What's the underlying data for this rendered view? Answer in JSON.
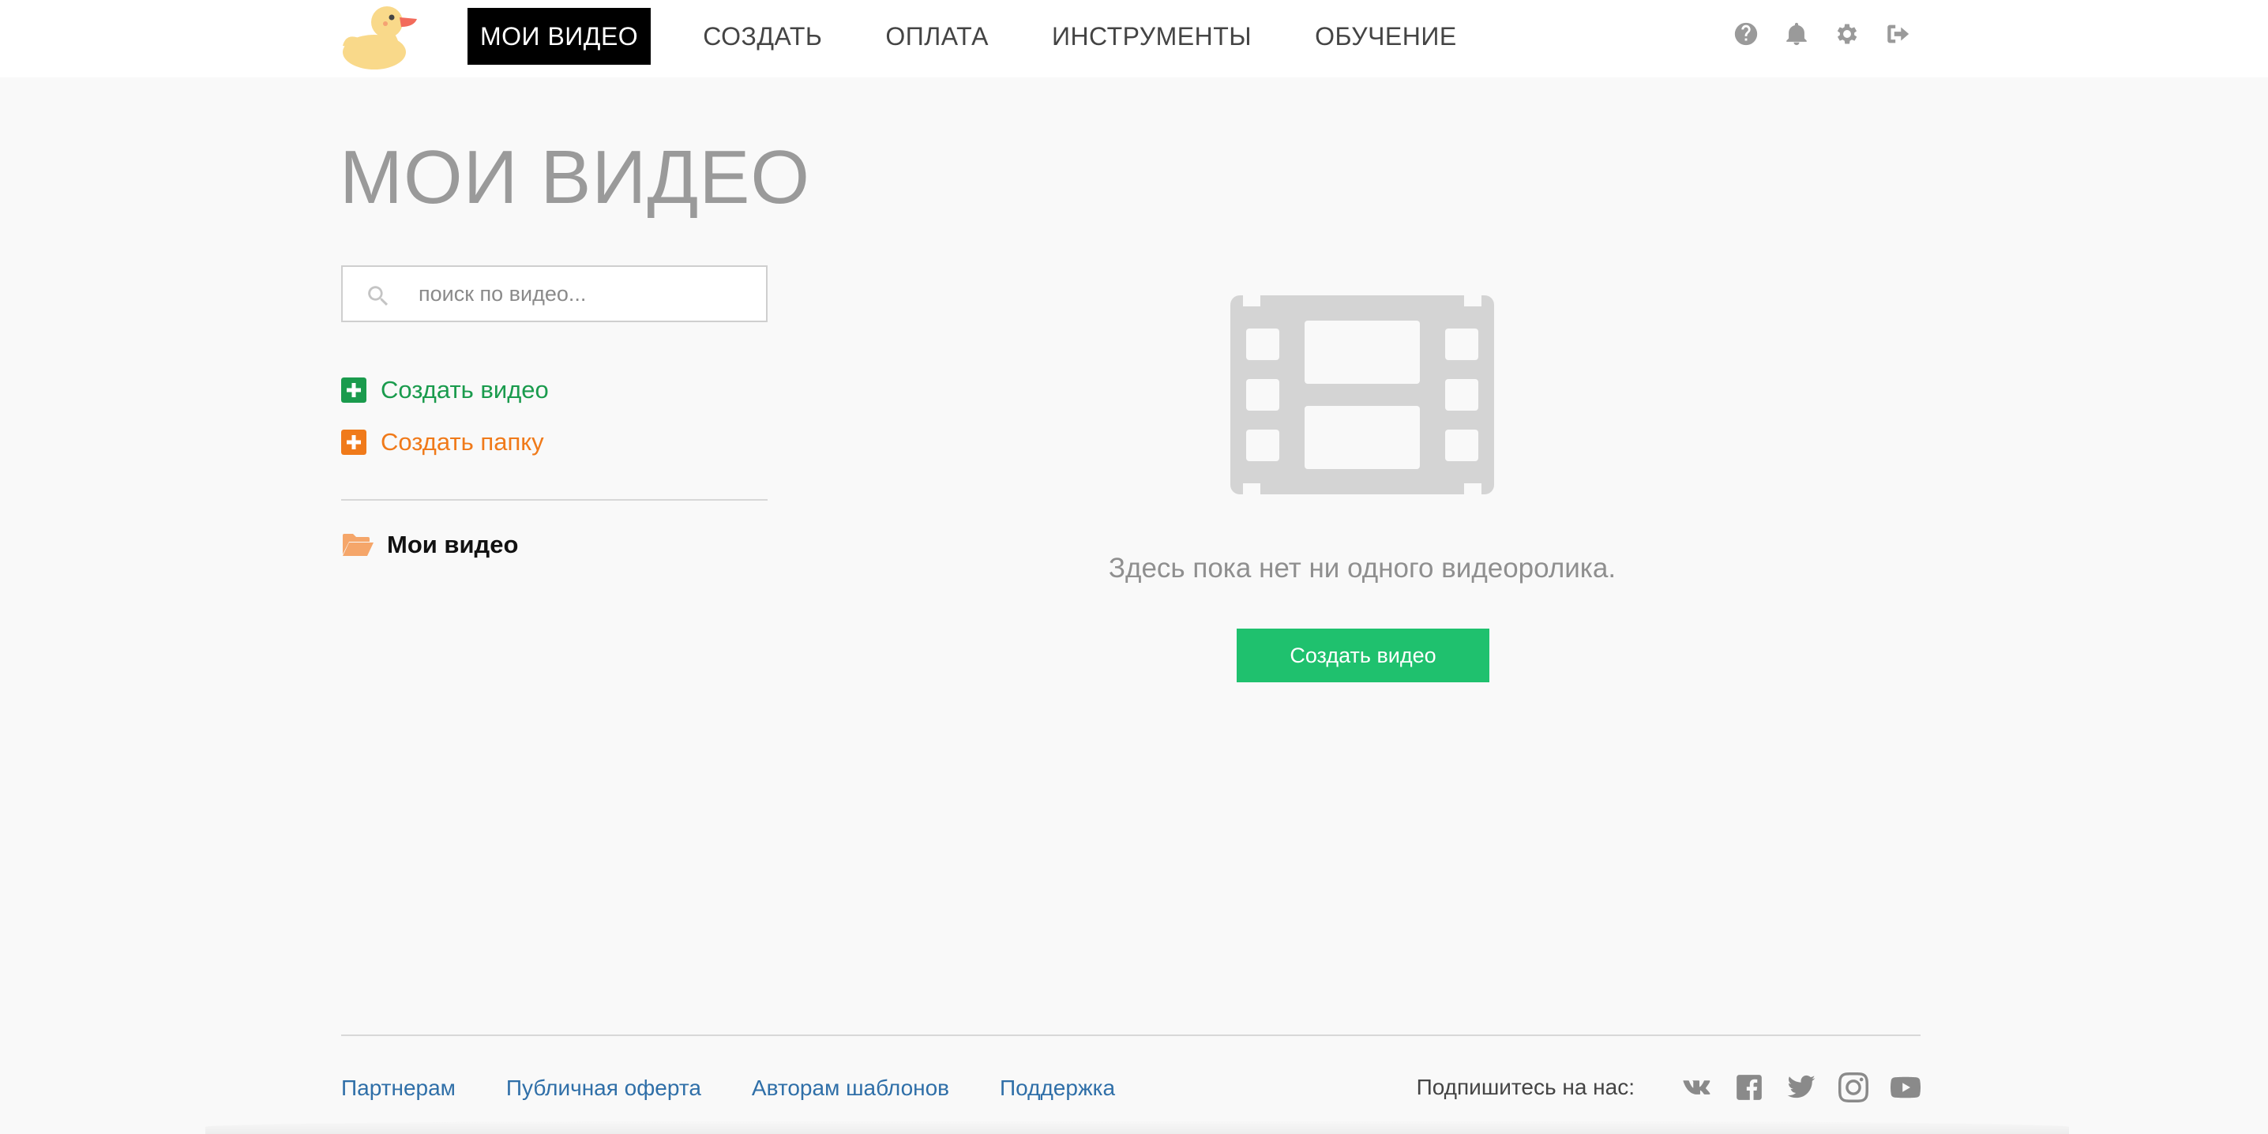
{
  "nav": {
    "items": [
      {
        "label": "МОИ ВИДЕО",
        "active": true
      },
      {
        "label": "СОЗДАТЬ",
        "active": false
      },
      {
        "label": "ОПЛАТА",
        "active": false
      },
      {
        "label": "ИНСТРУМЕНТЫ",
        "active": false
      },
      {
        "label": "ОБУЧЕНИЕ",
        "active": false
      }
    ],
    "icons": [
      "help-icon",
      "bell-icon",
      "gear-icon",
      "logout-icon"
    ]
  },
  "page": {
    "title": "МОИ ВИДЕО"
  },
  "search": {
    "placeholder": "поиск по видео...",
    "value": ""
  },
  "actions": {
    "create_video": "Создать видео",
    "create_folder": "Создать папку"
  },
  "folders": [
    {
      "label": "Мои видео"
    }
  ],
  "empty_state": {
    "message": "Здесь пока нет ни одного видеоролика.",
    "button": "Создать видео"
  },
  "footer": {
    "links": [
      "Партнерам",
      "Публичная оферта",
      "Авторам шаблонов",
      "Поддержка"
    ],
    "subscribe_label": "Подпишитесь на нас:",
    "social": [
      "vk-icon",
      "facebook-icon",
      "twitter-icon",
      "instagram-icon",
      "youtube-icon"
    ]
  },
  "colors": {
    "active_nav_bg": "#000000",
    "green_action": "#1a9b4d",
    "orange_action": "#f07a1a",
    "primary_button": "#1fc16e",
    "link": "#2f6fa8",
    "logo_yellow": "#f9d98a",
    "logo_beak": "#f26b5b"
  }
}
